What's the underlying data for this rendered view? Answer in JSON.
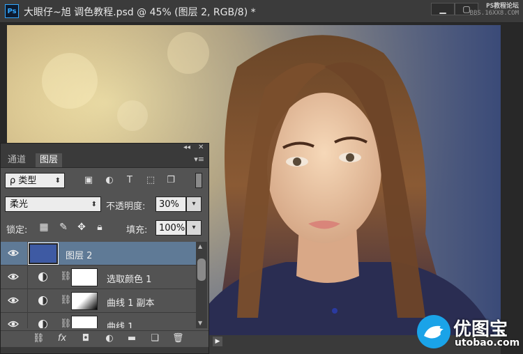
{
  "window": {
    "title": "大眼仔~旭 调色教程.psd @ 45% (图层 2, RGB/8) *",
    "app_icon": "Ps",
    "minimize_label": "▁",
    "restore_label": "▢",
    "watermark_top_line1": "PS教程论坛",
    "watermark_top_line2": "BBS.16XX8.COM"
  },
  "layers_panel": {
    "tabs": [
      {
        "label": "通道",
        "active": false
      },
      {
        "label": "图层",
        "active": true
      }
    ],
    "collapse_label": "◂◂",
    "close_label": "✕",
    "menu_label": "▾≡",
    "filter": {
      "label": "ρ 类型"
    },
    "blend_mode": "柔光",
    "opacity_label": "不透明度:",
    "opacity_value": "30%",
    "lock_label": "锁定:",
    "fill_label": "填充:",
    "fill_value": "100%",
    "layers": [
      {
        "name": "图层 2",
        "type": "solid",
        "color": "#3e5aa3",
        "selected": true
      },
      {
        "name": "选取颜色 1",
        "type": "adjustment",
        "mask": "white",
        "selected": false
      },
      {
        "name": "曲线 1 副本",
        "type": "adjustment",
        "mask": "gradient",
        "selected": false
      },
      {
        "name": "曲线 1",
        "type": "adjustment",
        "mask": "white",
        "selected": false
      }
    ],
    "bottom_icons": [
      "link-icon",
      "fx-icon",
      "mask-icon",
      "adjustment-icon",
      "folder-icon",
      "new-layer-icon",
      "trash-icon"
    ]
  },
  "watermark": {
    "title": "优图宝",
    "url": "utobao.com"
  },
  "colors": {
    "selected_row": "#5f7a96",
    "panel_bg": "#535353",
    "layer2_fill": "#3e5aa3"
  }
}
